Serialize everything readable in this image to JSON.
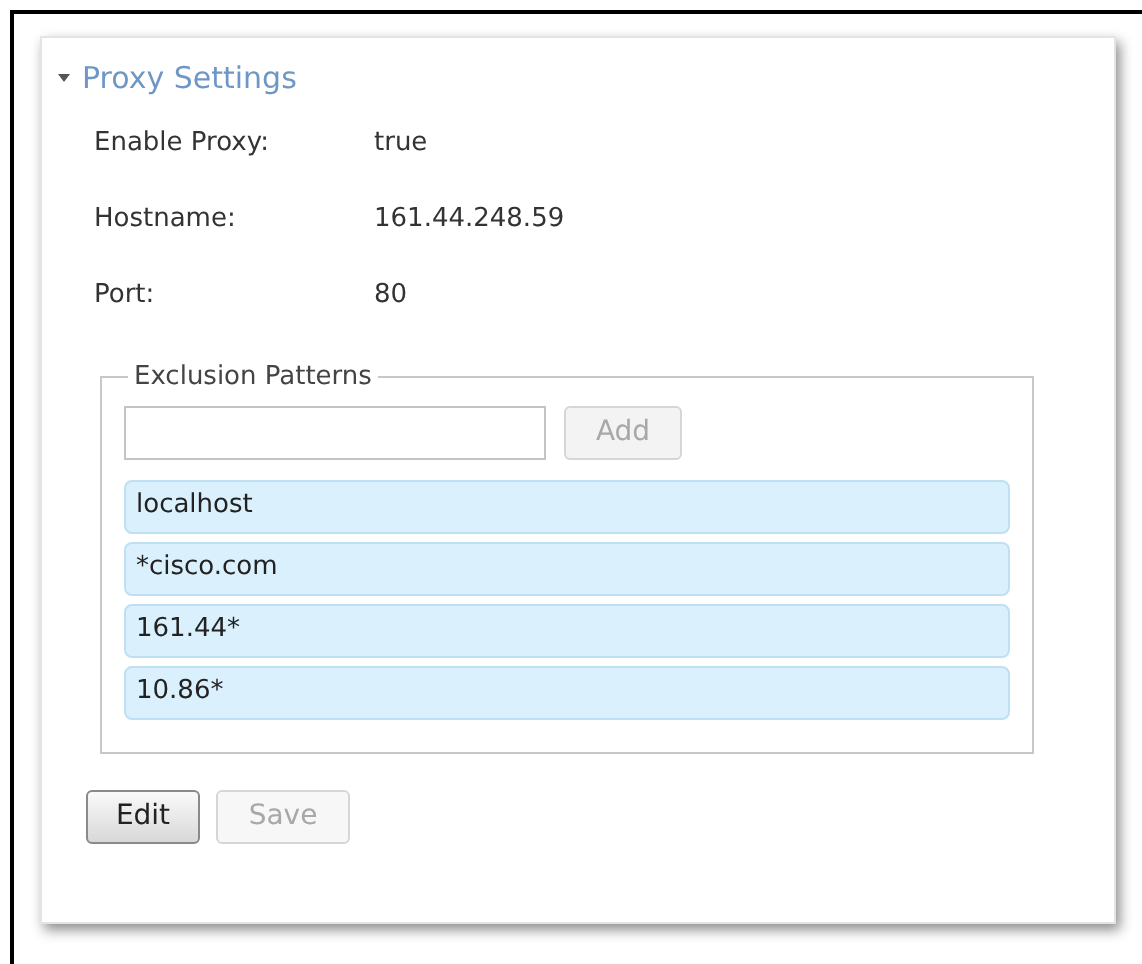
{
  "section": {
    "title": "Proxy Settings",
    "expanded": true
  },
  "fields": [
    {
      "label": "Enable Proxy:",
      "value": "true"
    },
    {
      "label": "Hostname:",
      "value": "161.44.248.59"
    },
    {
      "label": "Port:",
      "value": "80"
    }
  ],
  "exclusions": {
    "legend": "Exclusion Patterns",
    "add_button": {
      "label": "Add",
      "disabled": true
    },
    "items": [
      "localhost",
      "*cisco.com",
      "161.44*",
      "10.86*"
    ]
  },
  "buttons": [
    {
      "label": "Edit",
      "disabled": false
    },
    {
      "label": "Save",
      "disabled": true
    }
  ]
}
